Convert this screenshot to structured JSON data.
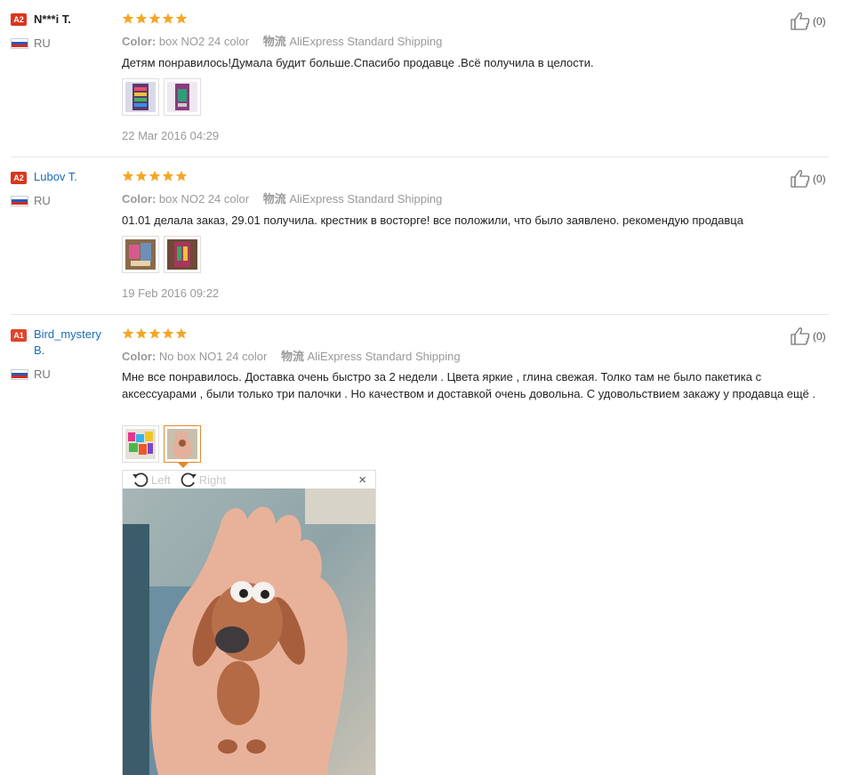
{
  "reviews": [
    {
      "badge": "A2",
      "username": "N***i T.",
      "country": "RU",
      "rating": 5,
      "color_label": "Color:",
      "color_value": "box NO2 24 color",
      "shipping_label": "物流",
      "shipping_value": "AliExpress Standard Shipping",
      "text": "Детям понравилось!Думала будит больше.Спасибо продавце .Всё получила в целости.",
      "date": "22 Mar 2016 04:29",
      "likes": "(0)"
    },
    {
      "badge": "A2",
      "username": "Lubov T.",
      "country": "RU",
      "rating": 5,
      "color_label": "Color:",
      "color_value": "box NO2 24 color",
      "shipping_label": "物流",
      "shipping_value": "AliExpress Standard Shipping",
      "text": "01.01 делала заказ, 29.01 получила. крестник в восторге! все положили, что было заявлено. рекомендую продавца",
      "date": "19 Feb 2016 09:22",
      "likes": "(0)"
    },
    {
      "badge": "A1",
      "username": "Bird_mystery B.",
      "country": "RU",
      "rating": 5,
      "color_label": "Color:",
      "color_value": "No box NO1 24 color",
      "shipping_label": "物流",
      "shipping_value": "AliExpress Standard Shipping",
      "text": "Мне все понравилось. Доставка очень быстро за 2 недели . Цвета яркие , глина свежая. Толко там не было пакетика с аксессуарами , были только три палочки . Но качеством и доставкой очень довольна. С удовольствием закажу у продавца ещё .",
      "likes": "(0)"
    }
  ],
  "viewer": {
    "rotate_left": "Left",
    "rotate_right": "Right",
    "close": "×"
  },
  "colors": {
    "star": "#f5a623",
    "link": "#1a6bb8",
    "badge": "#d9371d",
    "active_thumb": "#e08a2c"
  },
  "icons": {
    "like": "thumbs-up-icon",
    "close": "close-icon",
    "rotate_left": "rotate-left-icon",
    "rotate_right": "rotate-right-icon"
  }
}
